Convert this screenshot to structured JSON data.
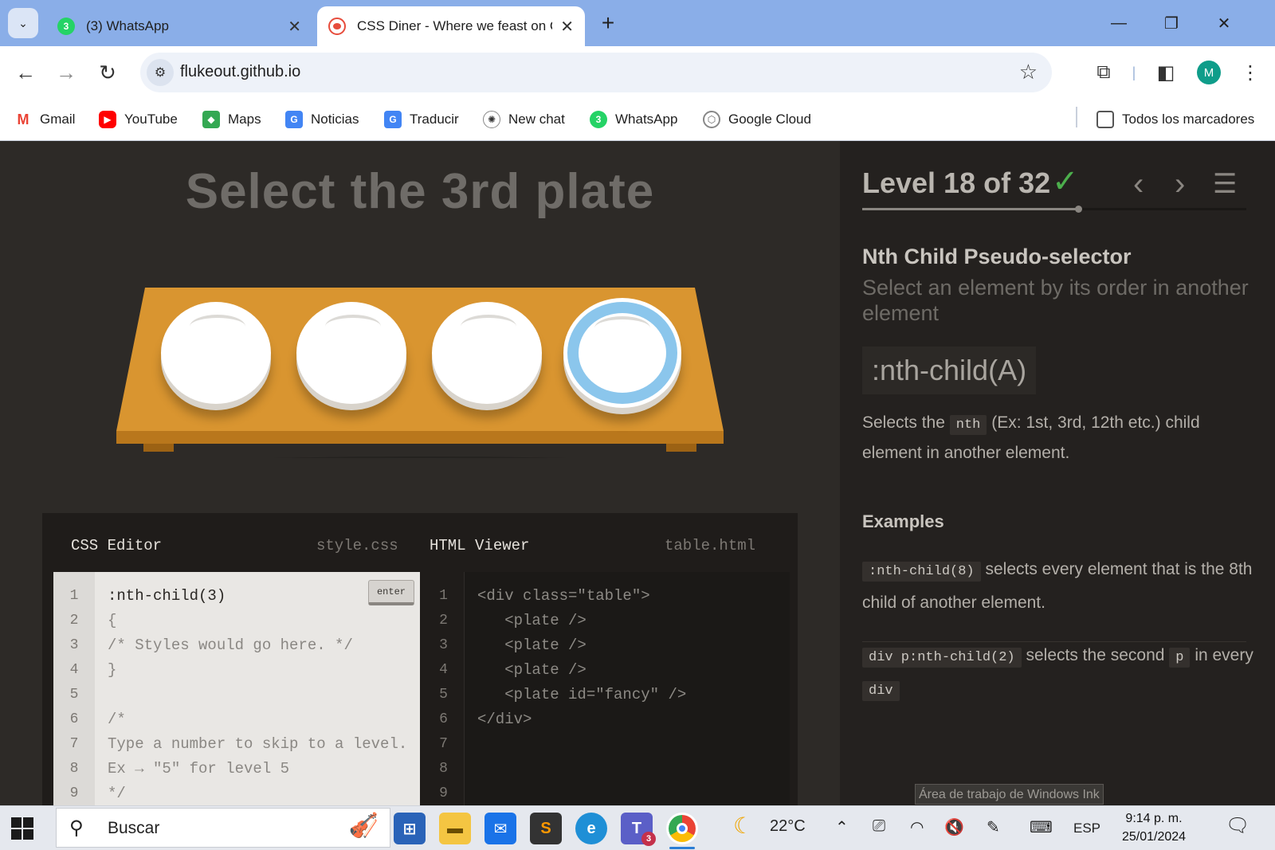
{
  "browser": {
    "tabs": [
      {
        "title": "(3) WhatsApp",
        "badge": "3",
        "active": false
      },
      {
        "title": "CSS Diner - Where we feast on CSS",
        "active": true
      }
    ],
    "url": "flukeout.github.io",
    "profile_initial": "M",
    "bookmarks": [
      {
        "label": "Gmail",
        "icon": "gmail-icon"
      },
      {
        "label": "YouTube",
        "icon": "youtube-icon"
      },
      {
        "label": "Maps",
        "icon": "maps-icon"
      },
      {
        "label": "Noticias",
        "icon": "news-icon"
      },
      {
        "label": "Traducir",
        "icon": "translate-icon"
      },
      {
        "label": "New chat",
        "icon": "chatgpt-icon"
      },
      {
        "label": "WhatsApp",
        "icon": "whatsapp-icon",
        "badge": "3"
      },
      {
        "label": "Google Cloud",
        "icon": "google-cloud-icon"
      }
    ],
    "all_bookmarks": "Todos los marcadores"
  },
  "game": {
    "instruction": "Select the 3rd plate",
    "editor": {
      "css_title": "CSS Editor",
      "css_file": "style.css",
      "html_title": "HTML Viewer",
      "html_file": "table.html",
      "enter_label": "enter",
      "css_lines": [
        ":nth-child(3)",
        "{",
        "/* Styles would go here. */",
        "}",
        "",
        "/*",
        "Type a number to skip to a level.",
        "Ex → \"5\" for level 5",
        "*/"
      ],
      "html_lines": [
        "<div class=\"table\">",
        "   <plate />",
        "   <plate />",
        "   <plate />",
        "   <plate id=\"fancy\" />",
        "</div>",
        "",
        "",
        ""
      ],
      "line_numbers": [
        "1",
        "2",
        "3",
        "4",
        "5",
        "6",
        "7",
        "8",
        "9"
      ]
    }
  },
  "sidebar": {
    "level_text": "Level 18 of 32",
    "level_current": 18,
    "level_total": 32,
    "completed_mark": "✓",
    "title": "Nth Child Pseudo-selector",
    "subtitle": "Select an element by its order in another element",
    "syntax": ":nth-child(A)",
    "desc_pre": "Selects the",
    "desc_code": "nth",
    "desc_post": "(Ex: 1st, 3rd, 12th etc.) child element in another element.",
    "examples_heading": "Examples",
    "example1_code": ":nth-child(8)",
    "example1_text": "selects every element that is the 8th child of another element.",
    "example2_code": "div p:nth-child(2)",
    "example2_text_a": "selects the second",
    "example2_code_b": "p",
    "example2_text_b": "in every",
    "example2_code_c": "div"
  },
  "tooltip": "Área de trabajo de Windows Ink",
  "taskbar": {
    "search_placeholder": "Buscar",
    "weather": "22°C",
    "language": "ESP",
    "time": "9:14 p. m.",
    "date": "25/01/2024",
    "teams_badge": "3"
  },
  "colors": {
    "accent_check": "#4cae4c",
    "table_wood": "#d99530",
    "fancy_plate_ring": "#8bc6ec"
  }
}
